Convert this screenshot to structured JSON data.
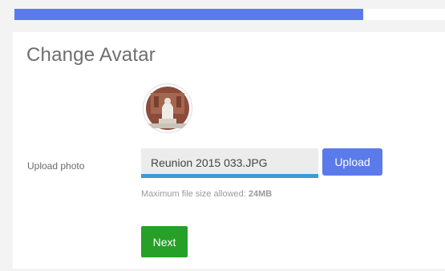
{
  "upload_progress": 0.81,
  "colors": {
    "progress_fill": "#5b7bea",
    "upload_underline": "#3e9ad6",
    "upload_button": "#5b7bea",
    "next_button": "#26a026"
  },
  "panel": {
    "title": "Change Avatar"
  },
  "avatar": {
    "icon": "user-photo-avatar"
  },
  "upload": {
    "label": "Upload photo",
    "file_name": "Reunion 2015 033.JPG",
    "button_label": "Upload",
    "hint_prefix": "Maximum file size allowed: ",
    "hint_value": "24MB"
  },
  "actions": {
    "next_label": "Next"
  }
}
